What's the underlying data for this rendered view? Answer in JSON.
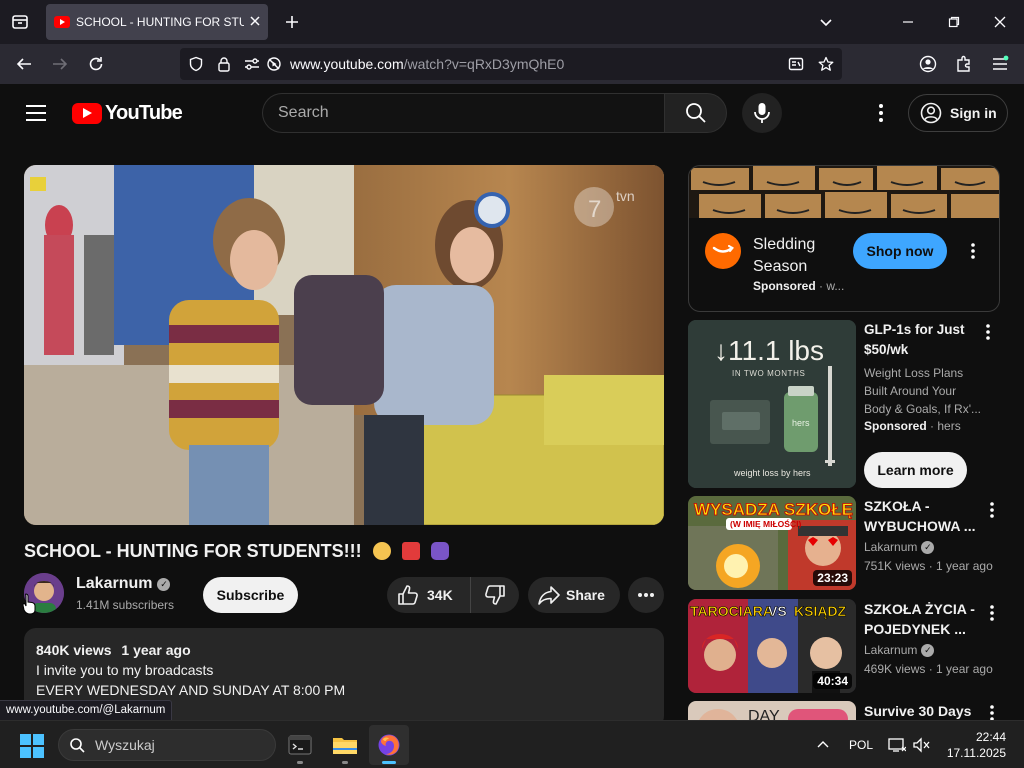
{
  "browser": {
    "tab_title": "SCHOOL - HUNTING FOR STUDENTS!!!",
    "url_host": "www.youtube.com",
    "url_path": "/watch?v=qRxD3ymQhE0",
    "status_link": "www.youtube.com/@Lakarnum"
  },
  "header": {
    "logo_text": "YouTube",
    "search_placeholder": "Search",
    "signin_label": "Sign in"
  },
  "video": {
    "title": "SCHOOL - HUNTING FOR STUDENTS!!!",
    "watermark": "tvn",
    "channel_name": "Lakarnum",
    "subscribers": "1.41M subscribers",
    "subscribe_label": "Subscribe",
    "like_count": "34K",
    "share_label": "Share",
    "views": "840K views",
    "age": "1 year ago",
    "desc_line1": "I invite you to my broadcasts",
    "desc_line2": "EVERY WEDNESDAY AND SUNDAY AT 8:00 PM"
  },
  "ad": {
    "title": "Sledding Season",
    "sponsored_label": "Sponsored",
    "advertiser_trunc": "w...",
    "button_label": "Shop now"
  },
  "sidebar": {
    "promo": {
      "thumb_headline": "11.1 lbs",
      "thumb_subhead": "IN TWO MONTHS",
      "thumb_bottle_label": "hers",
      "thumb_footer": "weight loss by hers",
      "title": "GLP-1s for Just $50/wk",
      "desc": "Weight Loss Plans Built Around Your Body & Goals, If Rx'...",
      "sponsored_label": "Sponsored",
      "advertiser": "hers",
      "button_label": "Learn more"
    },
    "items": [
      {
        "thumb_text": "WYSADZA SZKOŁĘ",
        "thumb_subtext": "(W IMIĘ MIŁOŚCI)",
        "title": "SZKOŁA - WYBUCHOWA ...",
        "channel": "Lakarnum",
        "views": "751K views",
        "age": "1 year ago",
        "duration": "23:23"
      },
      {
        "thumb_text_left": "TAROCIARA",
        "thumb_text_mid": "VS",
        "thumb_text_right": "KSIĄDZ",
        "title": "SZKOŁA ŻYCIA - POJEDYNEK ...",
        "channel": "Lakarnum",
        "views": "469K views",
        "age": "1 year ago",
        "duration": "40:34"
      },
      {
        "thumb_text": "DAY",
        "title": "Survive 30 Days"
      }
    ]
  },
  "taskbar": {
    "search_label": "Wyszukaj",
    "language": "POL",
    "time": "22:44",
    "date": "17.11.2025"
  },
  "colors": {
    "yt_red": "#ff0000",
    "accent_blue": "#3ea6ff",
    "background": "#0f0f0f"
  },
  "icons": [
    "tab-list-icon",
    "close-icon",
    "plus-icon",
    "chevron-down-icon",
    "minimize-icon",
    "maximize-icon",
    "back-icon",
    "forward-icon",
    "reload-icon",
    "shield-icon",
    "lock-icon",
    "permissions-icon",
    "camera-off-icon",
    "reader-icon",
    "star-icon",
    "account-icon",
    "extensions-icon",
    "menu-icon",
    "hamburger-icon",
    "search-icon",
    "mic-icon",
    "more-icon",
    "user-circle-icon",
    "thumb-up-icon",
    "thumb-down-icon",
    "share-icon",
    "windows-icon",
    "terminal-icon",
    "folder-icon",
    "firefox-icon",
    "chevron-up-icon",
    "network-icon"
  ]
}
